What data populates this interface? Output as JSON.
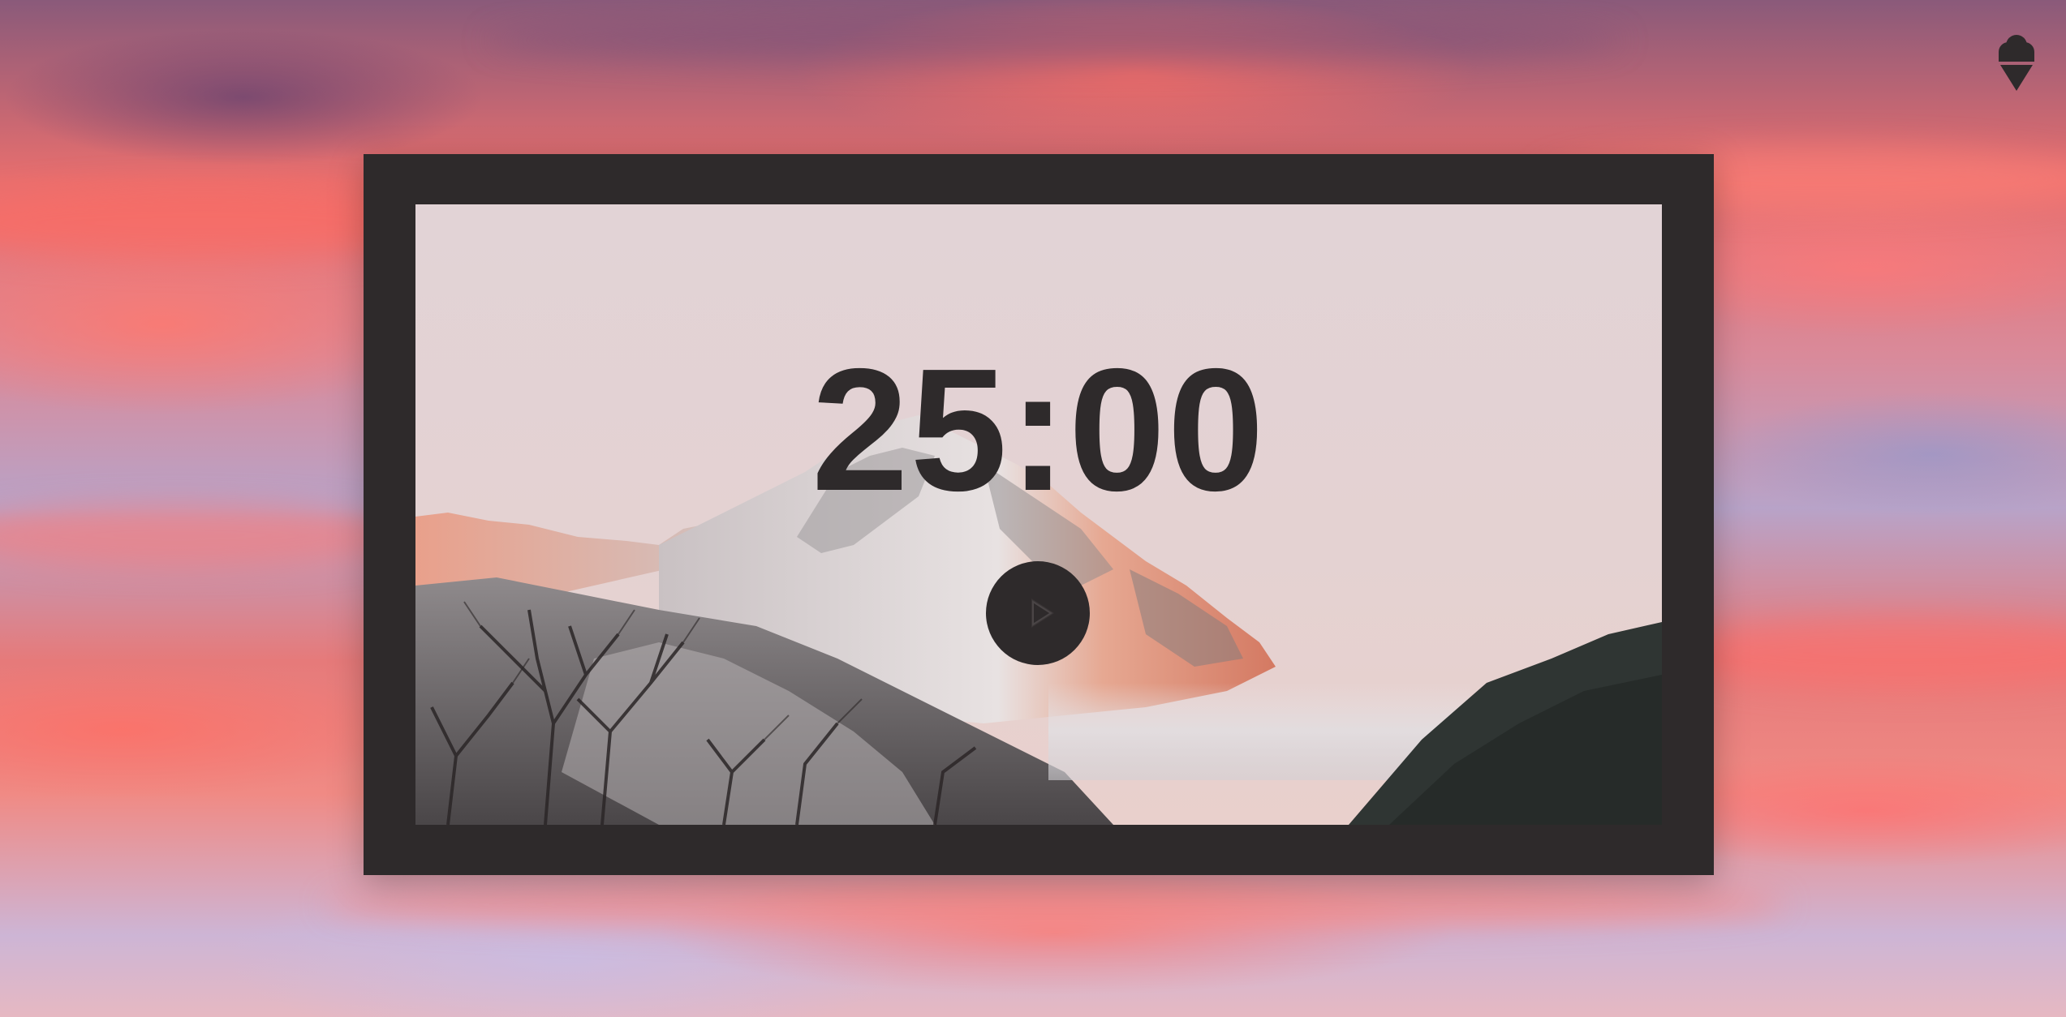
{
  "timer": {
    "display": "25:00"
  },
  "controls": {
    "play_icon": "play-icon"
  },
  "header": {
    "logo_icon": "ice-cream-icon"
  },
  "colors": {
    "frame": "#2e2a2b",
    "timer_text": "#2e2a2b",
    "sky": "#e96f6e"
  }
}
